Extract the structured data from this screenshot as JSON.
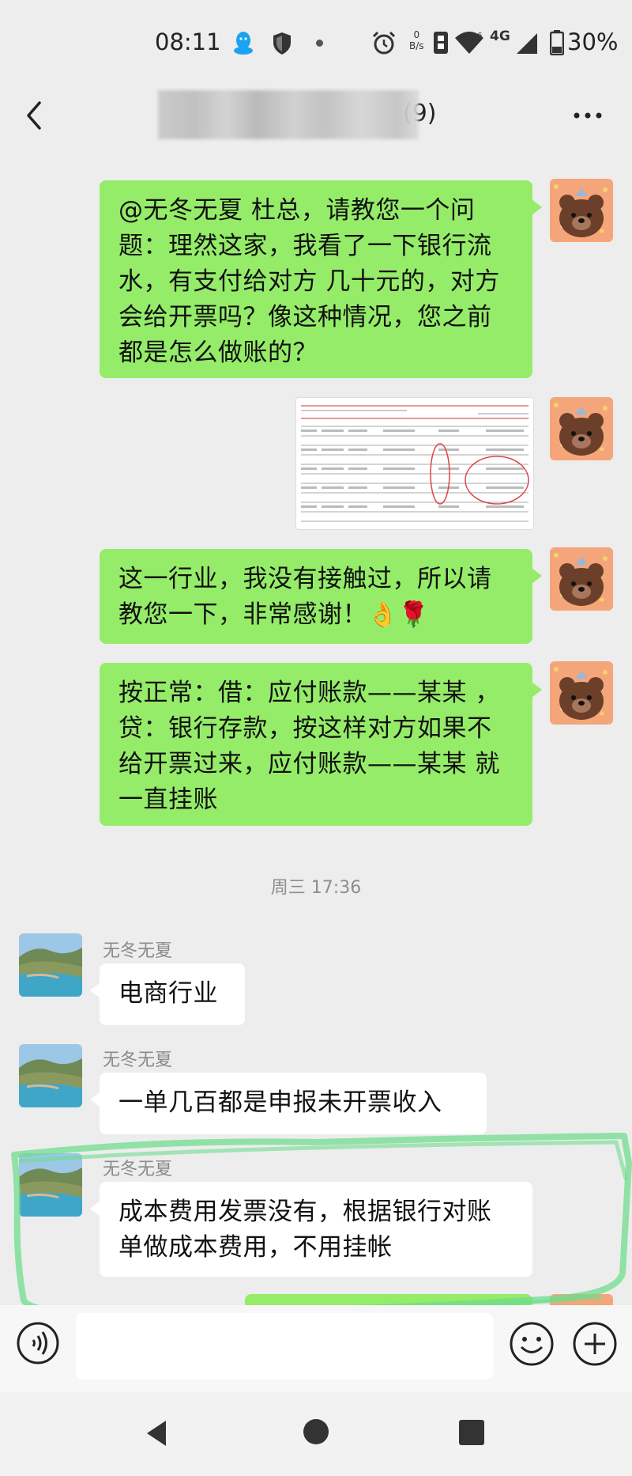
{
  "status_bar": {
    "time": "08:11",
    "net_speed_value": "0",
    "net_speed_unit": "B/s",
    "network": "4G",
    "battery": "30%"
  },
  "header": {
    "title": "(9)"
  },
  "messages": [
    {
      "side": "right",
      "text": "@无冬无夏  杜总，请教您一个问题：理然这家，我看了一下银行流水，有支付给对方 几十元的，对方会给开票吗？像这种情况，您之前都是怎么做账的？"
    },
    {
      "side": "right",
      "type": "image"
    },
    {
      "side": "right",
      "text": "这一行业，我没有接触过，所以请教您一下，非常感谢！👌🌹"
    },
    {
      "side": "right",
      "text": "按正常：借：应付账款——某某 ，贷：银行存款，按这样对方如果不给开票过来，应付账款——某某 就一直挂账"
    },
    {
      "side": "time",
      "text": "周三 17:36"
    },
    {
      "side": "left",
      "sender": "无冬无夏",
      "text": "电商行业"
    },
    {
      "side": "left",
      "sender": "无冬无夏",
      "text": "一单几百都是申报未开票收入"
    },
    {
      "side": "left",
      "sender": "无冬无夏",
      "text": "成本费用发票没有，根据银行对账单做成本费用，不用挂帐"
    }
  ],
  "colors": {
    "my_bubble": "#95ec69",
    "their_bubble": "#ffffff",
    "background": "#ededed",
    "highlight_stroke": "#6fdc8c"
  },
  "icons": [
    "back-icon",
    "more-icon",
    "voice-icon",
    "emoji-icon",
    "plus-icon",
    "qq-icon",
    "shield-icon",
    "alarm-icon",
    "wifi-icon",
    "signal-icon",
    "battery-icon"
  ]
}
